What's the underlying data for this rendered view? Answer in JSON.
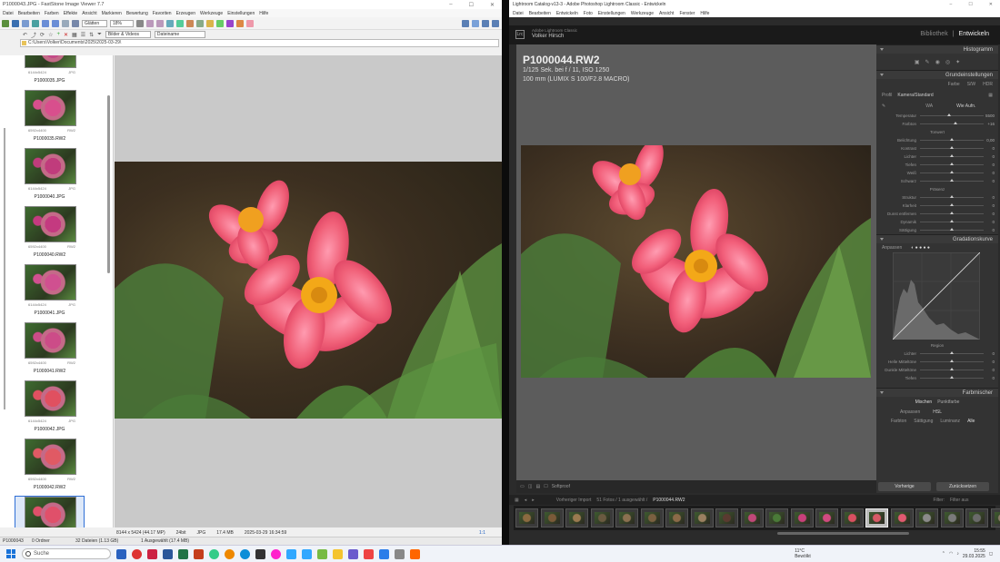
{
  "faststone": {
    "window_title": "P1000043.JPG - FastStone Image Viewer 7.7",
    "menu": [
      "Datei",
      "Bearbeiten",
      "Farben",
      "Effekte",
      "Ansicht",
      "Markieren",
      "Bewertung",
      "Favoriten",
      "Erzeugen",
      "Werkzeuge",
      "Einstellungen",
      "Hilfe"
    ],
    "toolbar": {
      "glaetten_label": "Glätten",
      "zoom": "18%",
      "filter": "Bilder & Videos",
      "sort": "Dateiname"
    },
    "address": "C:\\Users\\Volker\\Documents\\2025\\2025-03-29\\",
    "thumbnails": [
      {
        "name": "P1000035.JPG",
        "dims": "6144x5424",
        "type": "JPG",
        "color": "#c44c88"
      },
      {
        "name": "P1000035.RW2",
        "dims": "6592x4400",
        "type": "RW2",
        "color": "#d84f8d"
      },
      {
        "name": "P1000040.JPG",
        "dims": "6144x5424",
        "type": "JPG",
        "color": "#c03c7c"
      },
      {
        "name": "P1000040.RW2",
        "dims": "6592x4400",
        "type": "RW2",
        "color": "#c43a80"
      },
      {
        "name": "P1000041.JPG",
        "dims": "6144x5424",
        "type": "JPG",
        "color": "#d05090"
      },
      {
        "name": "P1000041.RW2",
        "dims": "6592x4400",
        "type": "RW2",
        "color": "#cc4c88"
      },
      {
        "name": "P1000042.JPG",
        "dims": "6144x5424",
        "type": "JPG",
        "color": "#e05060"
      },
      {
        "name": "P1000042.RW2",
        "dims": "6592x4400",
        "type": "RW2",
        "color": "#e05a64"
      },
      {
        "name": "P1000043.JPG",
        "dims": "6144x5424",
        "type": "JPG",
        "color": "#e0506a"
      }
    ],
    "status": {
      "dims": "8144 x 5424 (44.17 MP)",
      "depth": "24bit",
      "format": "JPG",
      "size": "17.4 MB",
      "date": "2025-03-29 16:34:59",
      "ratio": "1:1"
    },
    "status2": {
      "file": "P1000043",
      "count": "0 Ordner",
      "files": "32 Dateien (1.13 GB)",
      "selected": "1 Ausgewählt (17.4 MB)"
    }
  },
  "lightroom": {
    "window_title": "Lightroom Catalog-v13-3 - Adobe Photoshop Lightroom Classic - Entwickeln",
    "menu": [
      "Datei",
      "Bearbeiten",
      "Entwickeln",
      "Foto",
      "Einstellungen",
      "Werkzeuge",
      "Ansicht",
      "Fenster",
      "Hilfe"
    ],
    "identity": {
      "line1": "Adobe Lightroom Classic",
      "name": "Volker Hirsch"
    },
    "modules": {
      "library": "Bibliothek",
      "develop": "Entwickeln"
    },
    "photo_info": {
      "filename": "P1000044.RW2",
      "exposure": "1/125 Sek. bei f / 11, ISO 1250",
      "lens": "100 mm (LUMIX S 100/F2.8 MACRO)"
    },
    "panels": {
      "histogram": "Histogramm",
      "basic": "Grundeinstellungen",
      "basic_tabs": [
        "Farbe",
        "S/W",
        "HDR"
      ],
      "profile_label": "Profil",
      "profile_value": "Kamera/Standard",
      "wb_label": "WA",
      "wb_value": "Wie Aufn.",
      "sliders1": [
        {
          "label": "Temperatur",
          "value": "5500",
          "pos": 0.45
        },
        {
          "label": "Farbton",
          "value": "+16",
          "pos": 0.55
        }
      ],
      "tone_label": "Tonwert",
      "sliders2": [
        {
          "label": "Belichtung",
          "value": "0,00",
          "pos": 0.5
        },
        {
          "label": "Kontrast",
          "value": "0",
          "pos": 0.5
        },
        {
          "label": "Lichter",
          "value": "0",
          "pos": 0.5
        },
        {
          "label": "Tiefen",
          "value": "0",
          "pos": 0.5
        },
        {
          "label": "Weiß",
          "value": "0",
          "pos": 0.5
        },
        {
          "label": "Schwarz",
          "value": "0",
          "pos": 0.5
        }
      ],
      "presence_label": "Präsenz",
      "sliders3": [
        {
          "label": "Struktur",
          "value": "0",
          "pos": 0.5
        },
        {
          "label": "Klarheit",
          "value": "0",
          "pos": 0.5
        },
        {
          "label": "Dunst entfernen",
          "value": "0",
          "pos": 0.5
        },
        {
          "label": "Dynamik",
          "value": "0",
          "pos": 0.5
        },
        {
          "label": "Sättigung",
          "value": "0",
          "pos": 0.5
        }
      ],
      "curve": "Gradationskurve",
      "curve_channel": "Anpassen",
      "region_label": "Region",
      "sliders4": [
        {
          "label": "Lichter",
          "value": "0",
          "pos": 0.5
        },
        {
          "label": "Helle Mitteltöne",
          "value": "0",
          "pos": 0.5
        },
        {
          "label": "Dunkle Mitteltöne",
          "value": "0",
          "pos": 0.5
        },
        {
          "label": "Tiefen",
          "value": "0",
          "pos": 0.5
        }
      ],
      "mixer": "Farbmischer",
      "mixer_modes": [
        "Mischen",
        "Punktfarbe"
      ],
      "mixer_sub": [
        "Anpassen",
        "HSL"
      ],
      "mixer_tabs": [
        "Farbton",
        "Sättigung",
        "Luminanz",
        "Alle"
      ]
    },
    "toolbar": {
      "softproof": "Softproof"
    },
    "buttons": {
      "previous": "Vorherige",
      "reset": "Zurücksetzen"
    },
    "filmstrip_bar": {
      "source": "Vorheriger Import",
      "counts": "51 Fotos / 1 ausgewählt /",
      "file": "P1000044.RW2",
      "filter_label": "Filter:",
      "filter_value": "Filter aus"
    }
  },
  "taskbar": {
    "search": "Suche",
    "weather_temp": "11°C",
    "weather_desc": "Bewölkt",
    "time": "15:55",
    "date": "29.03.2025"
  }
}
